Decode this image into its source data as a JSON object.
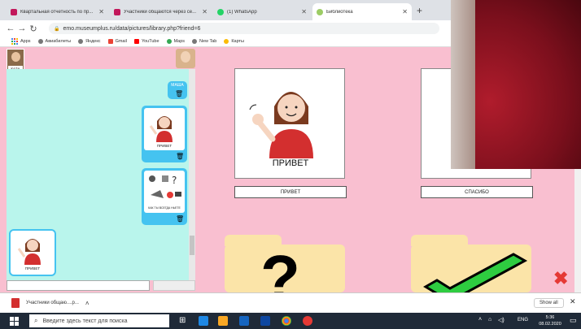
{
  "tabs": [
    {
      "title": "Квартальная отчетность по пр...",
      "color": "#c2185b",
      "active": false
    },
    {
      "title": "Участники общаются через се...",
      "color": "#c2185b",
      "active": false
    },
    {
      "title": "(1) WhatsApp",
      "color": "#25d366",
      "active": false
    },
    {
      "title": "Библиотека",
      "color": "#9ccc65",
      "active": true
    }
  ],
  "new_tab_label": "+",
  "url": "emo.museumplus.ru/data/pictures/library.php?friend=6",
  "bookmarks": [
    "Apps",
    "Авиабилеты",
    "Яндекс",
    "Gmail",
    "YouTube",
    "Maps",
    "New Tab",
    "Карты"
  ],
  "chat": {
    "top_user": "КАЗА",
    "name_badge": "МАША",
    "sent_card_label": "ПРИВЕТ",
    "second_card_caption": "КАК ТЫ ВСЕГДА НЬЕТЕ",
    "received_card_label": "ПРИВЕТ"
  },
  "library": {
    "cards": [
      {
        "title": "ПРИВЕТ",
        "label": "ПРИВЕТ"
      },
      {
        "title": "",
        "label": "СПАСИБО"
      }
    ]
  },
  "colors": {
    "page_bg": "#f9bfd0",
    "chat_bg": "#b9f5ec",
    "bubble": "#45c3f0",
    "accent_red": "#e53935",
    "check_green": "#2ecc40"
  },
  "download": {
    "filename": "Участники общаю....р...",
    "show_all": "Show all"
  },
  "taskbar": {
    "search_placeholder": "Введите здесь текст для поиска",
    "lang": "ENG",
    "time": "5:36",
    "date": "08.02.2020"
  }
}
